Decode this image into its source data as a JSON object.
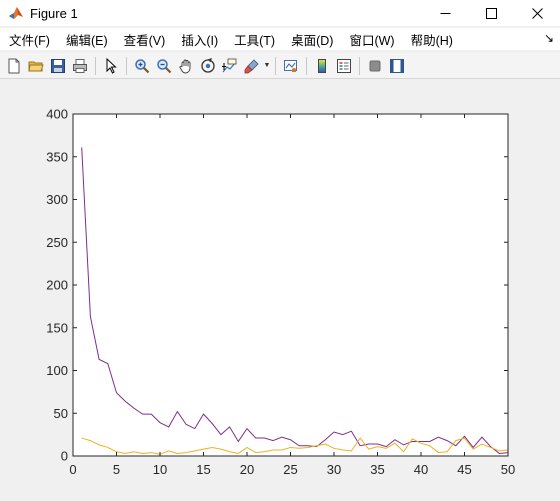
{
  "window": {
    "title": "Figure 1",
    "minimize_icon": "minimize-icon",
    "maximize_icon": "maximize-icon",
    "close_icon": "close-icon"
  },
  "menu": [
    {
      "label": "文件(F)"
    },
    {
      "label": "编辑(E)"
    },
    {
      "label": "查看(V)"
    },
    {
      "label": "插入(I)"
    },
    {
      "label": "工具(T)"
    },
    {
      "label": "桌面(D)"
    },
    {
      "label": "窗口(W)"
    },
    {
      "label": "帮助(H)"
    }
  ],
  "menu_overflow": "↘",
  "toolbar": [
    "new-figure-icon",
    "open-file-icon",
    "save-icon",
    "print-icon",
    "pointer-icon",
    "zoom-in-icon",
    "zoom-out-icon",
    "pan-icon",
    "rotate-3d-icon",
    "data-cursor-icon",
    "brush-icon",
    "link-plot-icon",
    "colorbar-icon",
    "legend-icon",
    "hide-plot-tools-icon",
    "show-plot-tools-icon"
  ],
  "chart_data": {
    "type": "line",
    "title": "",
    "xlabel": "",
    "ylabel": "",
    "xlim": [
      0,
      50
    ],
    "ylim": [
      0,
      400
    ],
    "xticks": [
      0,
      5,
      10,
      15,
      20,
      25,
      30,
      35,
      40,
      45,
      50
    ],
    "yticks": [
      0,
      50,
      100,
      150,
      200,
      250,
      300,
      350,
      400
    ],
    "grid": false,
    "legend": "none",
    "x": [
      1,
      2,
      3,
      4,
      5,
      6,
      7,
      8,
      9,
      10,
      11,
      12,
      13,
      14,
      15,
      16,
      17,
      18,
      19,
      20,
      21,
      22,
      23,
      24,
      25,
      26,
      27,
      28,
      29,
      30,
      31,
      32,
      33,
      34,
      35,
      36,
      37,
      38,
      39,
      40,
      41,
      42,
      43,
      44,
      45,
      46,
      47,
      48,
      49,
      50
    ],
    "series": [
      {
        "color": "#7e2f8e",
        "values": [
          361,
          163,
          113,
          108,
          74,
          64,
          56,
          49,
          49,
          39,
          34,
          52,
          37,
          32,
          49,
          38,
          25,
          34,
          17,
          32,
          21,
          21,
          18,
          22,
          19,
          12,
          12,
          11,
          19,
          28,
          25,
          29,
          12,
          14,
          14,
          11,
          19,
          13,
          17,
          17,
          17,
          22,
          18,
          12,
          23,
          10,
          22,
          11,
          3,
          4
        ]
      },
      {
        "color": "#edb120",
        "values": [
          21,
          18,
          13,
          10,
          5,
          3,
          5,
          3,
          4,
          2,
          6,
          3,
          4,
          6,
          8,
          10,
          8,
          5,
          3,
          10,
          4,
          5,
          7,
          7,
          10,
          9,
          10,
          12,
          14,
          9,
          7,
          6,
          21,
          8,
          11,
          9,
          15,
          5,
          20,
          15,
          12,
          4,
          5,
          18,
          21,
          8,
          14,
          10,
          6,
          7
        ]
      }
    ]
  }
}
